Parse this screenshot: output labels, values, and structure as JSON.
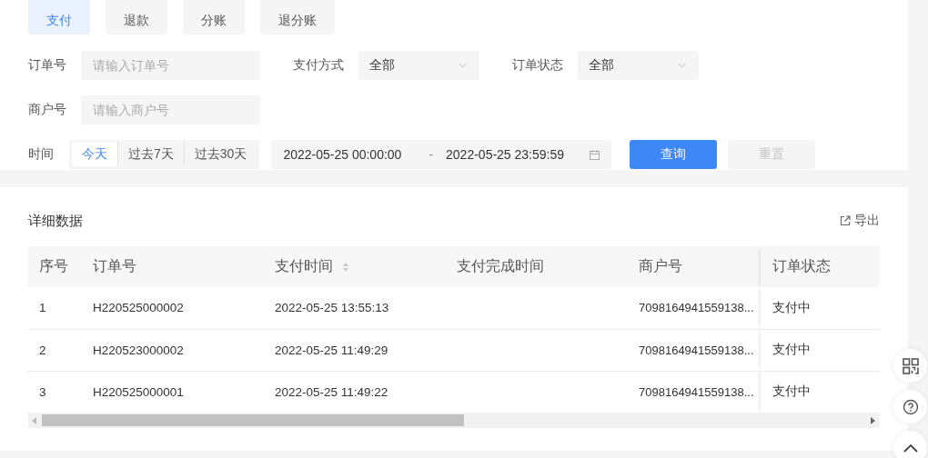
{
  "tabs": [
    {
      "label": "支付",
      "selected": true
    },
    {
      "label": "退款",
      "selected": false
    },
    {
      "label": "分账",
      "selected": false
    },
    {
      "label": "退分账",
      "selected": false
    }
  ],
  "filter_rows": [
    [
      {
        "kind": "input",
        "label": "订单号",
        "placeholder": "请输入订单号"
      },
      {
        "kind": "select",
        "label": "支付方式",
        "value": "全部"
      },
      {
        "kind": "select",
        "label": "订单状态",
        "value": "全部"
      }
    ],
    [
      {
        "kind": "input",
        "label": "商户号",
        "placeholder": "请输入商户号"
      }
    ]
  ],
  "time_filter": {
    "label": "时间",
    "presets": [
      {
        "label": "今天",
        "selected": true
      },
      {
        "label": "过去7天",
        "selected": false
      },
      {
        "label": "过去30天",
        "selected": false
      }
    ],
    "start": "2022-05-25 00:00:00",
    "separator": "-",
    "end": "2022-05-25 23:59:59"
  },
  "buttons": [
    {
      "label": "查询",
      "disabled": false
    },
    {
      "label": "重置",
      "disabled": true
    }
  ],
  "detail": {
    "title": "详细数据",
    "export": "导出",
    "columns": [
      {
        "label": "序号",
        "sortable": false
      },
      {
        "label": "订单号",
        "sortable": false
      },
      {
        "label": "支付时间",
        "sortable": true
      },
      {
        "label": "支付完成时间",
        "sortable": false
      },
      {
        "label": "商户号",
        "sortable": false
      },
      {
        "label": "订单状态",
        "sortable": false
      }
    ],
    "rows": [
      [
        "1",
        "H220525000002",
        "2022-05-25 13:55:13",
        null,
        "7098164941559138...",
        "支付中"
      ],
      [
        "2",
        "H220523000002",
        "2022-05-25 11:49:29",
        null,
        "7098164941559138...",
        "支付中"
      ],
      [
        "3",
        "H220525000001",
        "2022-05-25 11:49:22",
        null,
        "7098164941559138...",
        "支付中"
      ]
    ]
  }
}
